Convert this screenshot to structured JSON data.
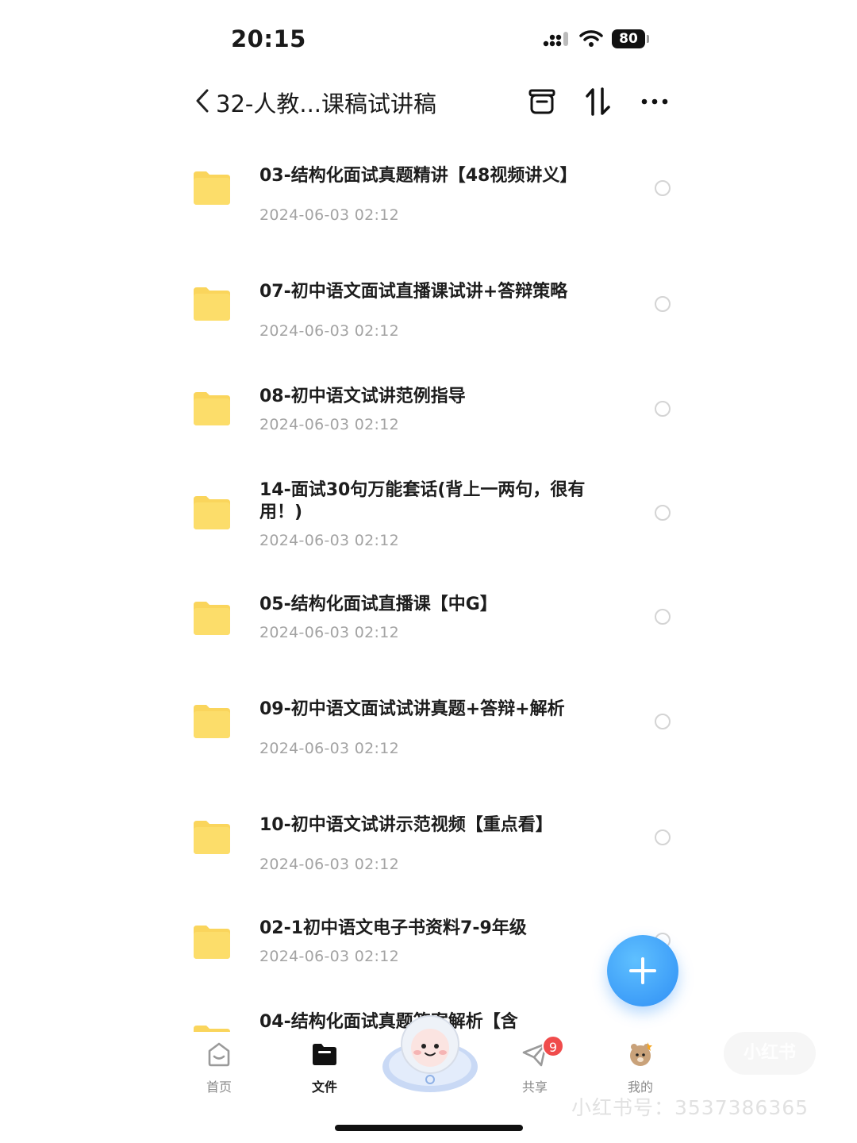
{
  "status_bar": {
    "time": "20:15",
    "battery": "80"
  },
  "header": {
    "title": "32-人教...课稿试讲稿"
  },
  "files": [
    {
      "name": "03-结构化面试真题精讲【48视频讲义】",
      "date": "2024-06-03 02:12"
    },
    {
      "name": "07-初中语文面试直播课试讲+答辩策略",
      "date": "2024-06-03 02:12"
    },
    {
      "name": "08-初中语文试讲范例指导",
      "date": "2024-06-03 02:12"
    },
    {
      "name": "14-面试30句万能套话(背上一两句，很有用！)",
      "date": "2024-06-03 02:12"
    },
    {
      "name": "05-结构化面试直播课【中G】",
      "date": "2024-06-03 02:12"
    },
    {
      "name": "09-初中语文面试试讲真题+答辩+解析",
      "date": "2024-06-03 02:12"
    },
    {
      "name": "10-初中语文试讲示范视频【重点看】",
      "date": "2024-06-03 02:12"
    },
    {
      "name": "02-1初中语文电子书资料7-9年级",
      "date": "2024-06-03 02:12"
    },
    {
      "name": "04-结构化面试真题答案解析【含",
      "date": ""
    }
  ],
  "bottom_nav": {
    "home": "首页",
    "files": "文件",
    "share": "共享",
    "mine": "我的",
    "share_badge": "9"
  },
  "watermark": {
    "text": "小红书号：3537386365",
    "logo": "小红书"
  },
  "colors": {
    "accent": "#2f8ff5",
    "folder": "#fad55c",
    "badge": "#f04c4c"
  }
}
